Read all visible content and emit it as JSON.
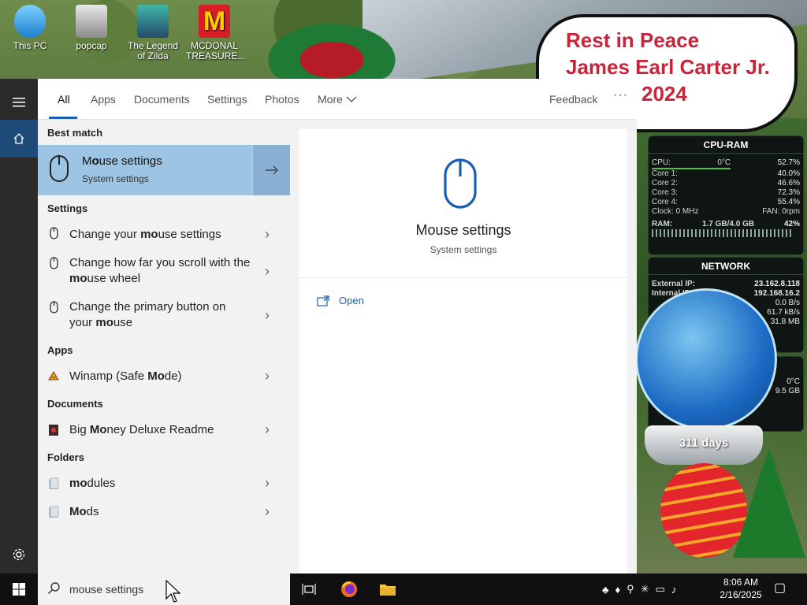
{
  "desktop": {
    "icons": [
      {
        "label": "This PC"
      },
      {
        "label": "popcap"
      },
      {
        "label": "The Legend of Zilda"
      },
      {
        "label": "MCDONAL TREASURE..."
      }
    ],
    "rip": {
      "line1": "Rest in Peace",
      "line2": "James Earl Carter Jr.",
      "line3": "2024"
    },
    "globe_days": "311 days",
    "cpu_widget": {
      "title": "CPU-RAM",
      "cpu_label": "CPU:",
      "cpu_temp": "0°C",
      "cpu_value": "52.7%",
      "cores": [
        {
          "label": "Core 1:",
          "value": "40.0%"
        },
        {
          "label": "Core 2:",
          "value": "46.6%"
        },
        {
          "label": "Core 3:",
          "value": "72.3%"
        },
        {
          "label": "Core 4:",
          "value": "55.4%"
        }
      ],
      "clock_label": "Clock: 0 MHz",
      "fan_label": "FAN: 0rpm",
      "ram_label": "RAM:",
      "ram_used": "1.7 GB/4.0 GB",
      "ram_value": "42%"
    },
    "net_widget": {
      "title": "NETWORK",
      "external_label": "External IP:",
      "external_value": "23.162.8.118",
      "internal_label": "Internal IP:",
      "internal_value": "192.168.16.2",
      "down_value": "0.0 B/s",
      "up_value": "61.7 kB/s",
      "total_value": "31.8 MB"
    },
    "w3": {
      "temp": "0°C",
      "size": "9.5 GB"
    }
  },
  "sidebar": {
    "menu": "hamburger-icon",
    "home": "home-icon",
    "settings": "gear-icon"
  },
  "tabs": {
    "all": "All",
    "apps": "Apps",
    "documents": "Documents",
    "settings": "Settings",
    "photos": "Photos",
    "more": "More",
    "feedback": "Feedback",
    "options": "···"
  },
  "results": {
    "best_match_header": "Best match",
    "best": {
      "title_pre": "M",
      "title_bold": "o",
      "title_post": "use settings",
      "subtitle": "System settings"
    },
    "settings_header": "Settings",
    "settings_items": [
      {
        "pre": "Change your ",
        "bold": "mo",
        "post": "use settings"
      },
      {
        "pre": "Change how far you scroll with the ",
        "bold": "mo",
        "post": "use wheel"
      },
      {
        "pre": "Change the primary button on your ",
        "bold": "mo",
        "post": "use"
      }
    ],
    "apps_header": "Apps",
    "app_item": {
      "pre": "Winamp (Safe ",
      "bold": "Mo",
      "post": "de)"
    },
    "documents_header": "Documents",
    "doc_item": {
      "pre": "Big ",
      "bold": "Mo",
      "post": "ney Deluxe Readme"
    },
    "folders_header": "Folders",
    "folders": [
      {
        "pre": "",
        "bold": "mo",
        "post": "dules"
      },
      {
        "pre": "",
        "bold": "Mo",
        "post": "ds"
      }
    ]
  },
  "preview": {
    "title": "Mouse settings",
    "subtitle": "System settings",
    "open": "Open"
  },
  "taskbar": {
    "search_value": "mouse settings",
    "time": "8:06 AM",
    "date": "2/16/2025"
  },
  "colors": {
    "accent": "#1a5fb4",
    "best_match_bg": "#9ec4e4"
  }
}
